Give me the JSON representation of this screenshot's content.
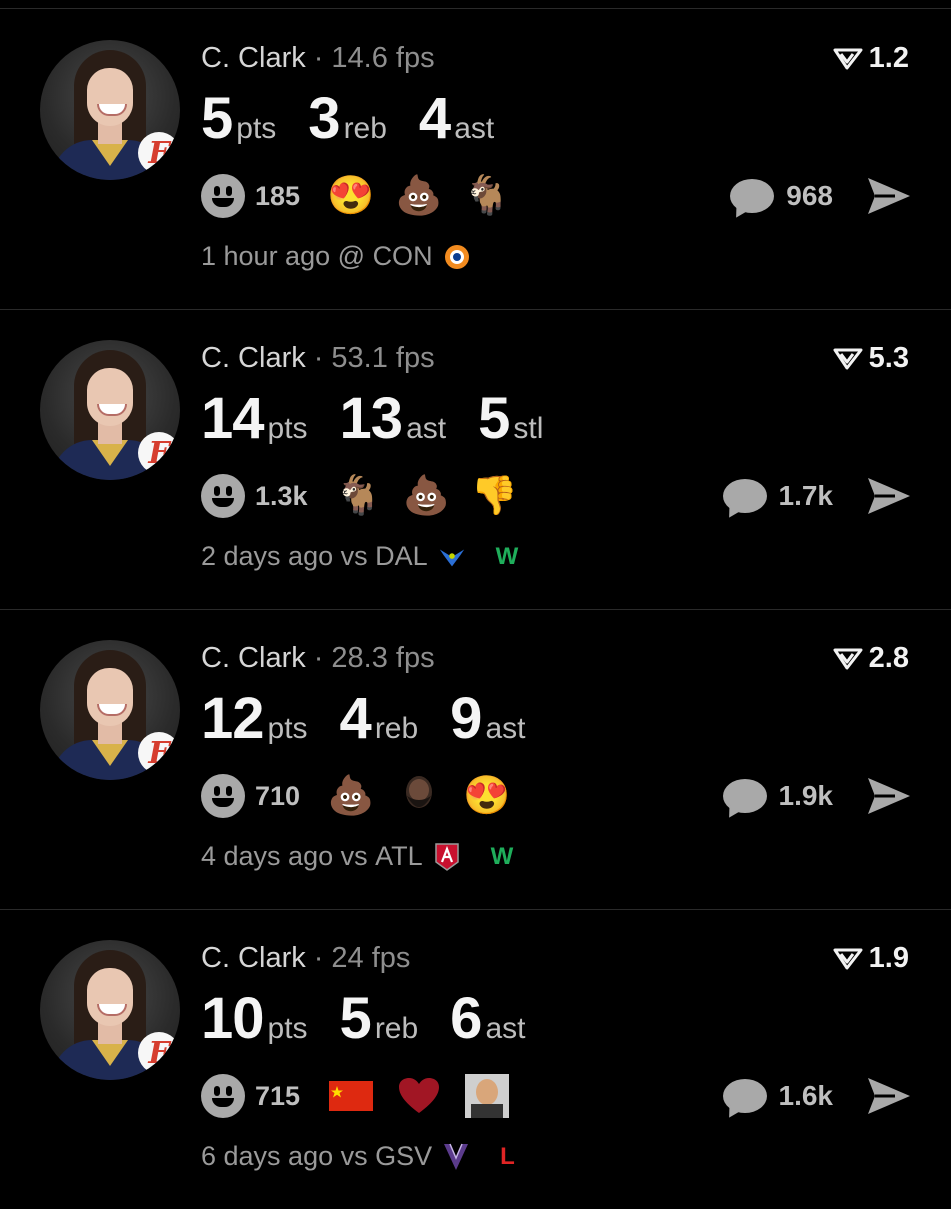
{
  "colors": {
    "background": "#000000",
    "win": "#1fae5b",
    "loss": "#e02424",
    "muted": "#9a9a9a"
  },
  "cards": [
    {
      "player": "C. Clark",
      "separator": "·",
      "fps": "14.6 fps",
      "rating": "1.2",
      "stats": [
        {
          "n": "5",
          "u": "pts"
        },
        {
          "n": "3",
          "u": "reb"
        },
        {
          "n": "4",
          "u": "ast"
        }
      ],
      "reactions_count": "185",
      "reaction_emojis": [
        "heart-eyes",
        "poop",
        "goat"
      ],
      "comments": "968",
      "time": "1 hour ago",
      "venue": "@",
      "opponent": "CON",
      "opponent_logo": "sun-logo",
      "result": ""
    },
    {
      "player": "C. Clark",
      "separator": "·",
      "fps": "53.1 fps",
      "rating": "5.3",
      "stats": [
        {
          "n": "14",
          "u": "pts"
        },
        {
          "n": "13",
          "u": "ast"
        },
        {
          "n": "5",
          "u": "stl"
        }
      ],
      "reactions_count": "1.3k",
      "reaction_emojis": [
        "goat",
        "poop",
        "thumbs-down"
      ],
      "comments": "1.7k",
      "time": "2 days ago",
      "venue": "vs",
      "opponent": "DAL",
      "opponent_logo": "wings-logo",
      "result": "W"
    },
    {
      "player": "C. Clark",
      "separator": "·",
      "fps": "28.3 fps",
      "rating": "2.8",
      "stats": [
        {
          "n": "12",
          "u": "pts"
        },
        {
          "n": "4",
          "u": "reb"
        },
        {
          "n": "9",
          "u": "ast"
        }
      ],
      "reactions_count": "710",
      "reaction_emojis": [
        "poop",
        "bearded-man",
        "heart-eyes"
      ],
      "comments": "1.9k",
      "time": "4 days ago",
      "venue": "vs",
      "opponent": "ATL",
      "opponent_logo": "dream-logo",
      "result": "W"
    },
    {
      "player": "C. Clark",
      "separator": "·",
      "fps": "24 fps",
      "rating": "1.9",
      "stats": [
        {
          "n": "10",
          "u": "pts"
        },
        {
          "n": "5",
          "u": "reb"
        },
        {
          "n": "6",
          "u": "ast"
        }
      ],
      "reactions_count": "715",
      "reaction_emojis": [
        "china-flag",
        "red-heart",
        "bald-man"
      ],
      "comments": "1.6k",
      "time": "6 days ago",
      "venue": "vs",
      "opponent": "GSV",
      "opponent_logo": "valkyries-logo",
      "result": "L"
    }
  ]
}
